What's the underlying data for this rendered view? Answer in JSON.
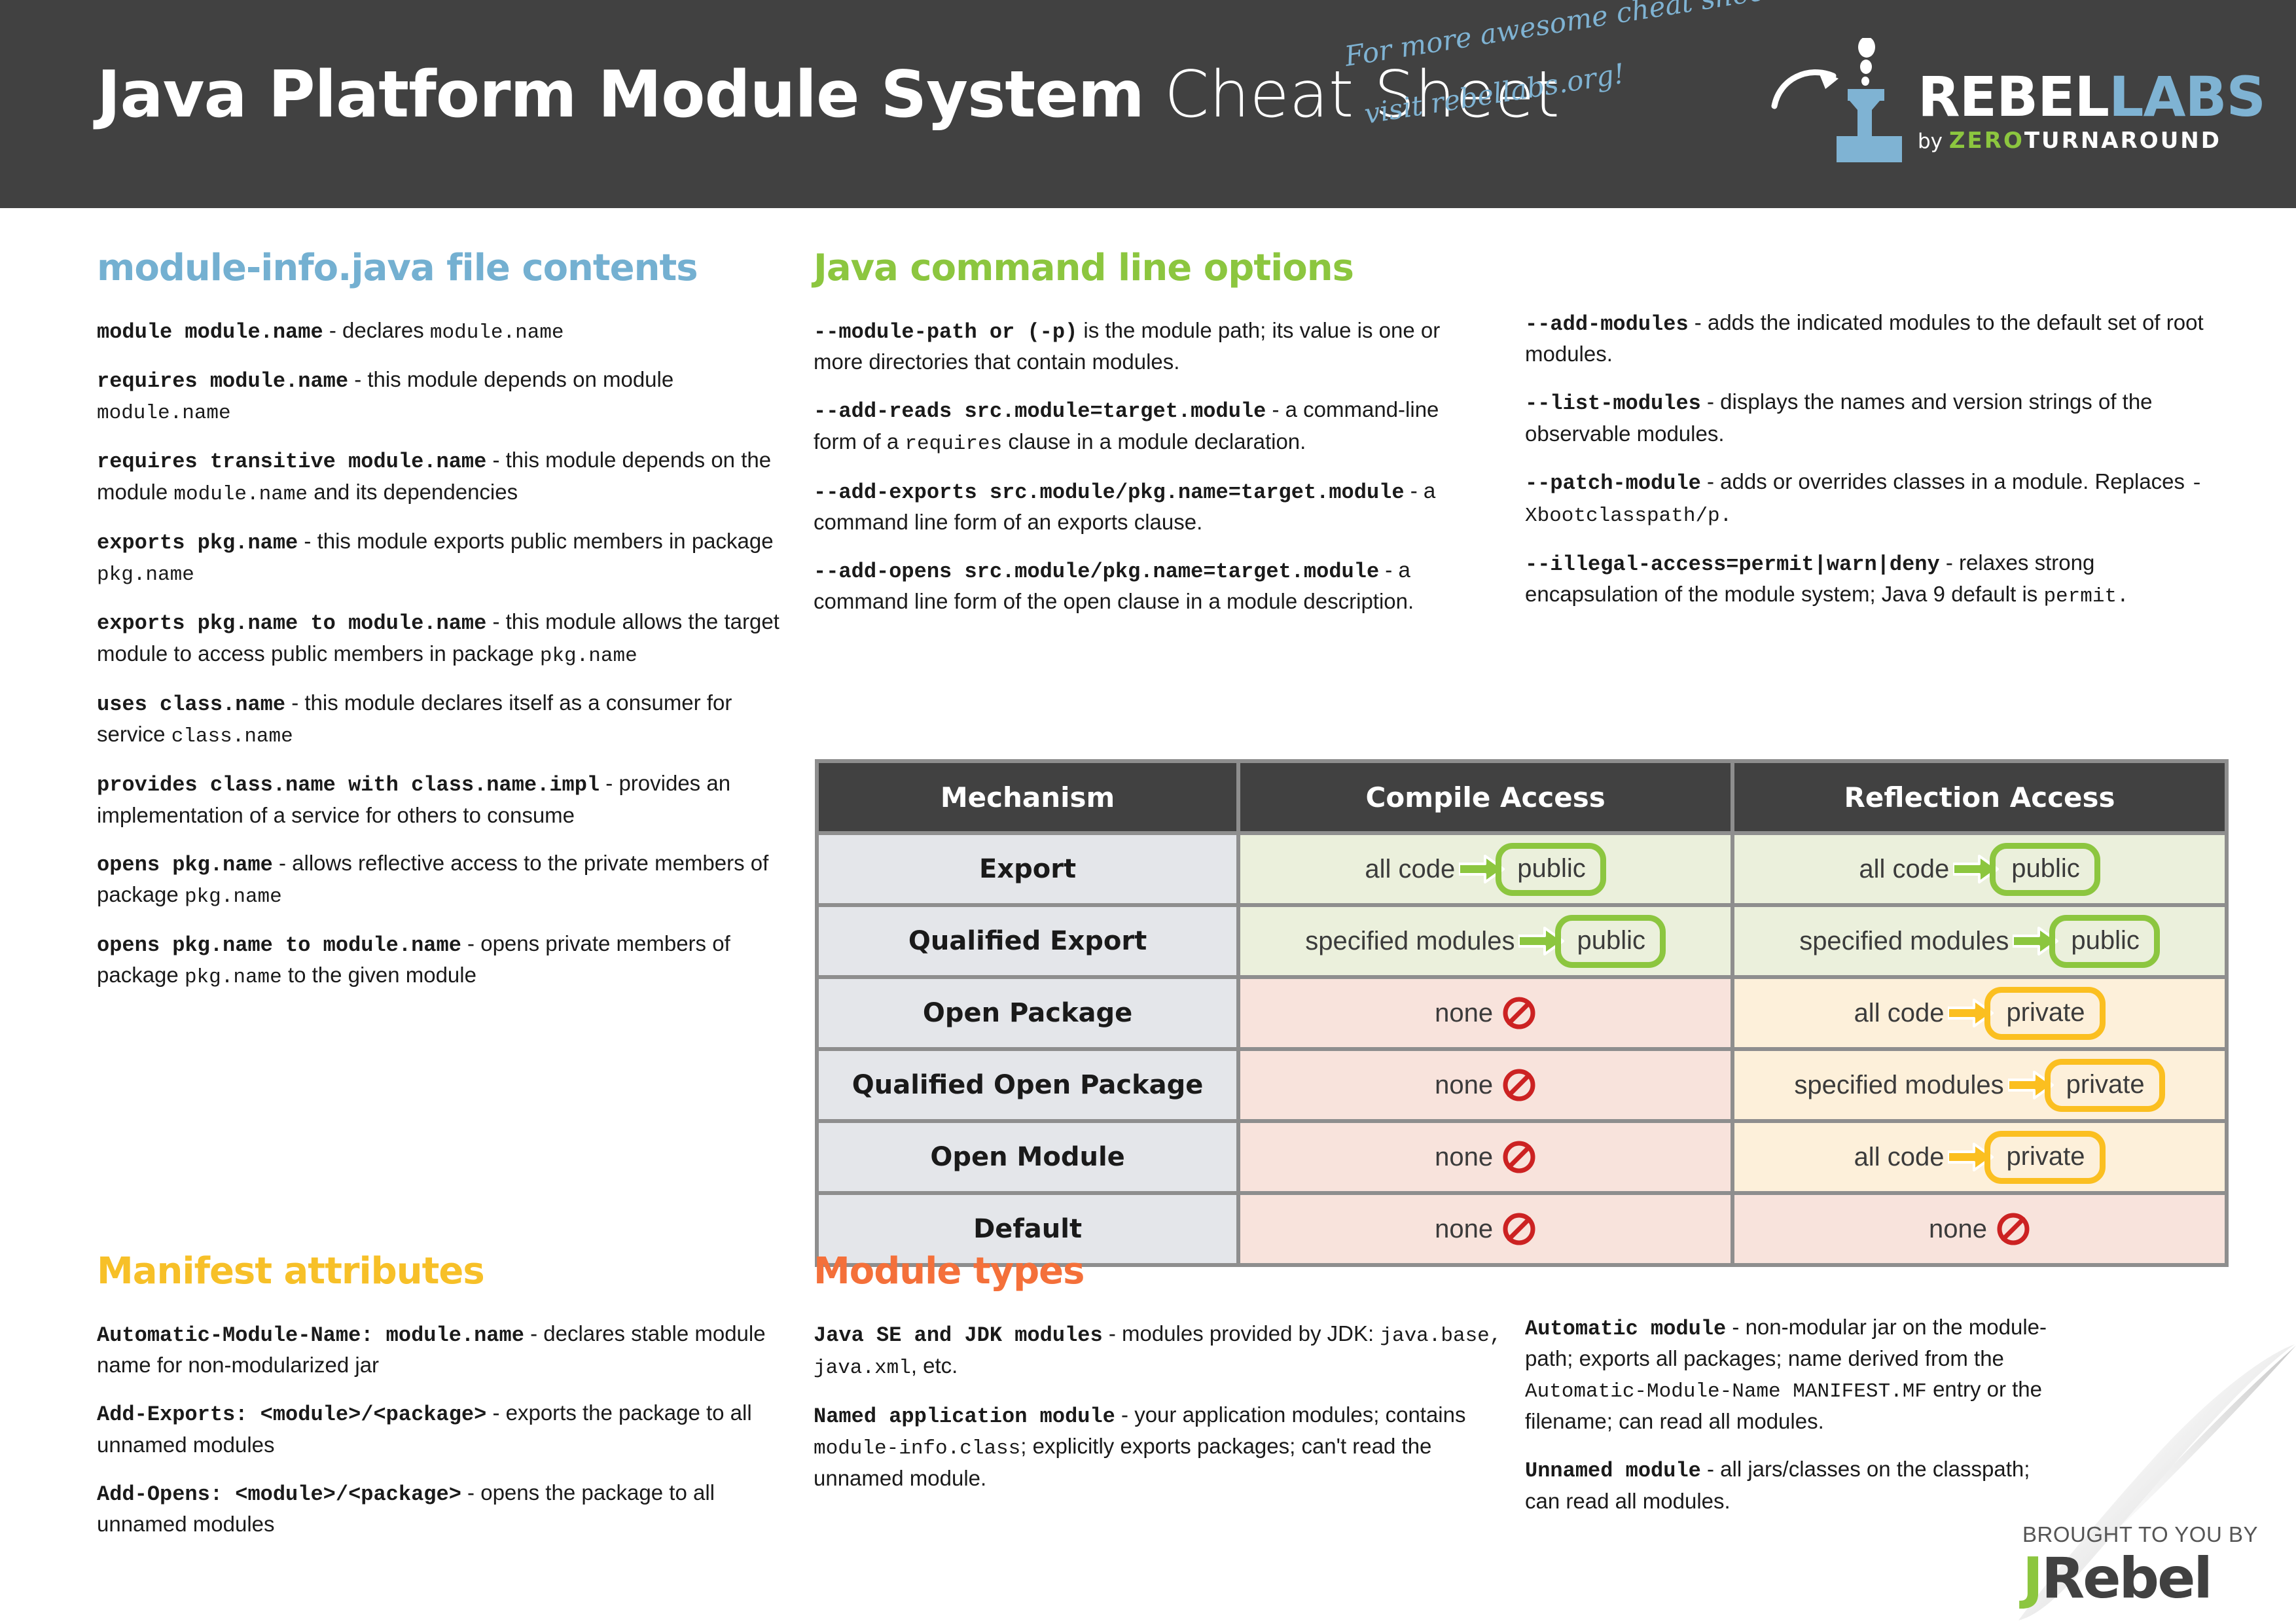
{
  "header": {
    "title_bold": "Java Platform Module System",
    "title_light": " Cheat Sheet",
    "handwriting_line1": "For more awesome cheat sheets",
    "handwriting_line2": "visit rebellabs.org!",
    "logo": {
      "name_part1": "REBEL",
      "name_part2": "LABS",
      "by_word": "by ",
      "by_zero": "ZERO",
      "by_turnaround": "TURNAROUND",
      "flask_icon": "flask-icon"
    },
    "bg_color": "#414141"
  },
  "sections": {
    "module_info": {
      "heading": "module-info.java file contents",
      "color": "#74b0d1",
      "entries": [
        {
          "code": "module module.name",
          "desc": " - declares ",
          "code_tail": "module.name",
          "tail": ""
        },
        {
          "code": "requires module.name",
          "desc": " - this module depends on module ",
          "code_tail": "module.name",
          "tail": ""
        },
        {
          "code": "requires transitive module.name",
          "desc": " - this module depends on the module ",
          "code_tail": "module.name",
          "tail": " and its dependencies"
        },
        {
          "code": "exports pkg.name",
          "desc": " - this module exports public members in package ",
          "code_tail": "pkg.name",
          "tail": ""
        },
        {
          "code": "exports pkg.name to module.name",
          "desc": "  - this module allows the target module to access public members in package ",
          "code_tail": "pkg.name",
          "tail": ""
        },
        {
          "code": "uses class.name",
          "desc": "  - this module declares itself as a consumer for service ",
          "code_tail": "class.name",
          "tail": ""
        },
        {
          "code": "provides class.name with class.name.impl",
          "desc": " - provides an implementation of a service for others to consume",
          "code_tail": "",
          "tail": ""
        },
        {
          "code": "opens pkg.name",
          "desc": " - allows reflective access to the private members of package ",
          "code_tail": "pkg.name",
          "tail": ""
        },
        {
          "code": "opens pkg.name to module.name",
          "desc": "  - opens private members of package ",
          "code_tail": "pkg.name",
          "tail": " to the given module"
        }
      ]
    },
    "manifest": {
      "heading": "Manifest attributes",
      "color": "#f7c028",
      "entries": [
        {
          "code": "Automatic-Module-Name: module.name",
          "desc": "  - declares stable module name for non-modularized jar",
          "code_tail": "",
          "tail": ""
        },
        {
          "code": "Add-Exports: <module>/<package>",
          "desc": " - exports the package to all unnamed modules",
          "code_tail": "",
          "tail": ""
        },
        {
          "code": "Add-Opens: <module>/<package>",
          "desc": " - opens the package to all unnamed modules",
          "code_tail": "",
          "tail": ""
        }
      ]
    },
    "cmdline": {
      "heading": "Java command line options",
      "color": "#8cc63f",
      "entries_left": [
        {
          "code": "--module-path or (-p)",
          "desc": " is the module path; its value is one or more directories that contain modules.",
          "code_tail": "",
          "tail": ""
        },
        {
          "code": "--add-reads src.module=target.module",
          "desc": " - a command-line form of a ",
          "code_tail": "requires",
          "tail": " clause in a module declaration."
        },
        {
          "code": "--add-exports src.module/pkg.name=target.module",
          "desc": " - a command line form of an exports clause.",
          "code_tail": "",
          "tail": ""
        },
        {
          "code": "--add-opens src.module/pkg.name=target.module",
          "desc": " - a command line form of the open clause in a module description.",
          "code_tail": "",
          "tail": ""
        }
      ],
      "entries_right": [
        {
          "code": "--add-modules",
          "desc": " - adds the indicated modules to the default set of root modules.",
          "code_tail": "",
          "tail": ""
        },
        {
          "code": "--list-modules",
          "desc": " - displays the names and version strings of the observable modules.",
          "code_tail": "",
          "tail": ""
        },
        {
          "code": "--patch-module",
          "desc": " - adds or overrides classes in a module. Replaces ",
          "code_tail": "-Xbootclasspath/p.",
          "tail": ""
        },
        {
          "code": "--illegal-access=permit|warn|deny",
          "desc": " - relaxes strong encapsulation of the module system; Java 9 default is ",
          "code_tail": "permit.",
          "tail": ""
        }
      ]
    },
    "module_types": {
      "heading": "Module types",
      "color": "#f4703a",
      "entries_left": [
        {
          "code": "Java SE and JDK modules",
          "desc": " - modules provided by JDK: ",
          "code_tail": "java.base, java.xml",
          "tail": ", etc."
        },
        {
          "code": "Named application module",
          "desc": " - your application modules; contains ",
          "code_tail": "module-info.class",
          "tail": "; explicitly exports packages; can't read the unnamed module."
        }
      ],
      "entries_right": [
        {
          "code": "Automatic module",
          "desc": " - non-modular jar on the module-path; exports all packages; name derived from the ",
          "code_tail": "Automatic-Module-Name MANIFEST.MF",
          "tail": " entry or the filename; can read all modules."
        },
        {
          "code": "Unnamed module",
          "desc": " - all jars/classes on the classpath; can read all modules.",
          "code_tail": "",
          "tail": ""
        }
      ]
    }
  },
  "access_table": {
    "headers": [
      "Mechanism",
      "Compile Access",
      "Reflection Access"
    ],
    "rows": [
      {
        "mechanism": "Export",
        "compile": {
          "kind": "flow",
          "source": "all code",
          "target": "public",
          "tone": "green"
        },
        "reflection": {
          "kind": "flow",
          "source": "all code",
          "target": "public",
          "tone": "green"
        }
      },
      {
        "mechanism": "Qualified Export",
        "compile": {
          "kind": "flow",
          "source": "specified modules",
          "target": "public",
          "tone": "green"
        },
        "reflection": {
          "kind": "flow",
          "source": "specified modules",
          "target": "public",
          "tone": "green"
        }
      },
      {
        "mechanism": "Open Package",
        "compile": {
          "kind": "none",
          "source": "none",
          "target": "",
          "tone": "red"
        },
        "reflection": {
          "kind": "flow",
          "source": "all code",
          "target": "private",
          "tone": "yellow"
        }
      },
      {
        "mechanism": "Qualified Open Package",
        "compile": {
          "kind": "none",
          "source": "none",
          "target": "",
          "tone": "red"
        },
        "reflection": {
          "kind": "flow",
          "source": "specified modules",
          "target": "private",
          "tone": "yellow"
        }
      },
      {
        "mechanism": "Open Module",
        "compile": {
          "kind": "none",
          "source": "none",
          "target": "",
          "tone": "red"
        },
        "reflection": {
          "kind": "flow",
          "source": "all code",
          "target": "private",
          "tone": "yellow"
        }
      },
      {
        "mechanism": "Default",
        "compile": {
          "kind": "none",
          "source": "none",
          "target": "",
          "tone": "red"
        },
        "reflection": {
          "kind": "none",
          "source": "none",
          "target": "",
          "tone": "red"
        }
      }
    ],
    "colors": {
      "header_bg": "#414141",
      "mechanism_bg": "#e4e6ea",
      "green_bg": "#ebf0dc",
      "red_bg": "#f8e3dc",
      "yellow_bg": "#fdf0da",
      "green_accent": "#8cc63f",
      "yellow_accent": "#fbbf20",
      "red_accent": "#cc2222"
    }
  },
  "footer": {
    "brought_by": "BROUGHT TO YOU BY",
    "brand_j": "J",
    "brand_rest": "Rebel"
  }
}
